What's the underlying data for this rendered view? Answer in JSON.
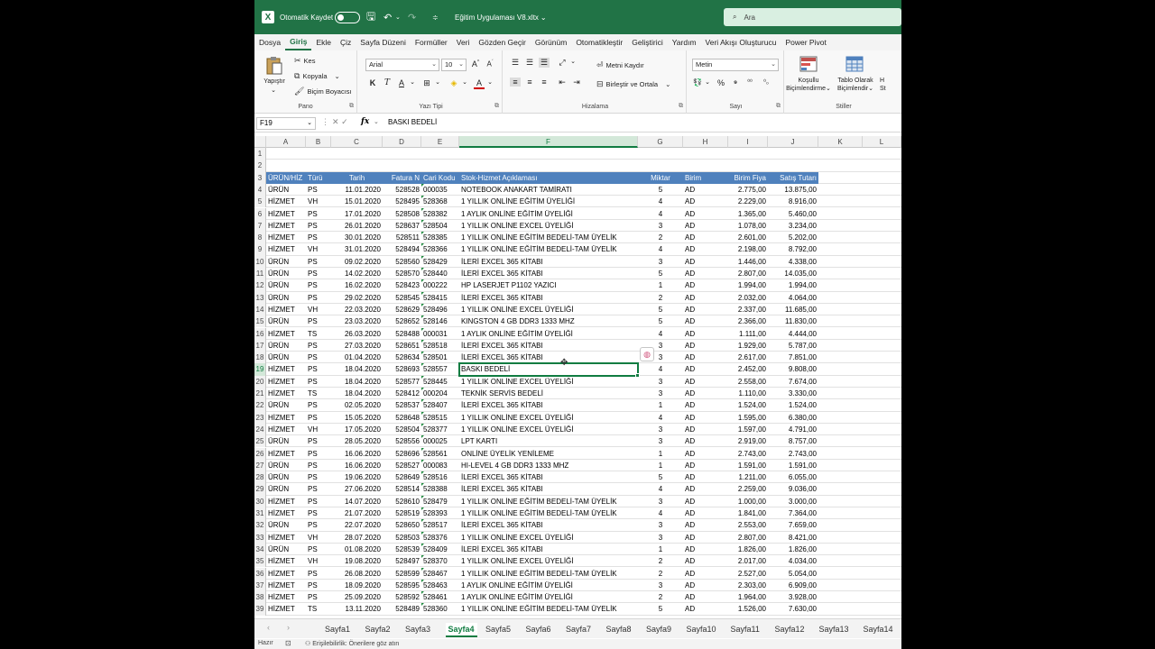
{
  "titlebar": {
    "autosave_label": "Otomatik Kaydet",
    "autosave_state": "off",
    "filename": "Eğitim Uygulaması V8.xltx",
    "search_placeholder": "Ara"
  },
  "menu_tabs": [
    "Dosya",
    "Giriş",
    "Ekle",
    "Çiz",
    "Sayfa Düzeni",
    "Formüller",
    "Veri",
    "Gözden Geçir",
    "Görünüm",
    "Otomatikleştir",
    "Geliştirici",
    "Yardım",
    "Veri Akışı Oluşturucu",
    "Power Pivot"
  ],
  "active_menu_tab": "Giriş",
  "ribbon": {
    "clipboard": {
      "paste": "Yapıştır",
      "cut": "Kes",
      "copy": "Kopyala",
      "format_painter": "Biçim Boyacısı",
      "group": "Pano"
    },
    "font": {
      "name": "Arial",
      "size": "10",
      "bold": "K",
      "italic": "T",
      "underline": "A",
      "group": "Yazı Tipi"
    },
    "alignment": {
      "wrap": "Metni Kaydır",
      "merge": "Birleştir ve Ortala",
      "group": "Hizalama"
    },
    "number": {
      "format": "Metin",
      "group": "Sayı"
    },
    "styles": {
      "conditional_line1": "Koşullu",
      "conditional_line2": "Biçimlendirme",
      "table_line1": "Tablo Olarak",
      "table_line2": "Biçimlendir",
      "cell_line1": "H",
      "cell_line2": "St",
      "group": "Stiller"
    }
  },
  "formula_bar": {
    "name_box": "F19",
    "fx": "fx",
    "content": "BASKI BEDELİ"
  },
  "columns": [
    "A",
    "B",
    "C",
    "D",
    "E",
    "F",
    "G",
    "H",
    "I",
    "J",
    "K",
    "L"
  ],
  "selected_column": "F",
  "selected_row": "19",
  "row_numbers": [
    "1",
    "2",
    "3",
    "4",
    "5",
    "6",
    "7",
    "8",
    "9",
    "10",
    "11",
    "12",
    "13",
    "14",
    "15",
    "16",
    "17",
    "18",
    "19",
    "20",
    "21",
    "22",
    "23",
    "24",
    "25",
    "26",
    "27",
    "28",
    "29",
    "30",
    "31",
    "32",
    "33",
    "34",
    "35",
    "36",
    "37",
    "38",
    "39"
  ],
  "table_headers": [
    "ÜRÜN/HİZ",
    "Türü",
    "Tarih",
    "Fatura N",
    "Cari Kodu",
    "Stok-Hizmet Açıklaması",
    "Miktar",
    "Birim",
    "Birim Fiya",
    "Satış Tutarı"
  ],
  "rows": [
    [
      "ÜRÜN",
      "PS",
      "11.01.2020",
      "528528",
      "000035",
      "NOTEBOOK ANAKART TAMİRATI",
      "5",
      "AD",
      "2.775,00",
      "13.875,00"
    ],
    [
      "HİZMET",
      "VH",
      "15.01.2020",
      "528495",
      "528368",
      "1 YILLIK ONLİNE EĞİTİM ÜYELİĞİ",
      "4",
      "AD",
      "2.229,00",
      "8.916,00"
    ],
    [
      "HİZMET",
      "PS",
      "17.01.2020",
      "528508",
      "528382",
      "1 AYLIK ONLİNE EĞİTİM ÜYELİĞİ",
      "4",
      "AD",
      "1.365,00",
      "5.460,00"
    ],
    [
      "HİZMET",
      "PS",
      "26.01.2020",
      "528637",
      "528504",
      "1 YILLIK ONLİNE EXCEL ÜYELİĞİ",
      "3",
      "AD",
      "1.078,00",
      "3.234,00"
    ],
    [
      "HİZMET",
      "PS",
      "30.01.2020",
      "528511",
      "528385",
      "1 YILLIK ONLİNE EĞİTİM BEDELİ-TAM ÜYELİK",
      "2",
      "AD",
      "2.601,00",
      "5.202,00"
    ],
    [
      "HİZMET",
      "VH",
      "31.01.2020",
      "528494",
      "528366",
      "1 YILLIK ONLİNE EĞİTİM BEDELİ-TAM ÜYELİK",
      "4",
      "AD",
      "2.198,00",
      "8.792,00"
    ],
    [
      "ÜRÜN",
      "PS",
      "09.02.2020",
      "528560",
      "528429",
      "İLERİ EXCEL 365 KİTABI",
      "3",
      "AD",
      "1.446,00",
      "4.338,00"
    ],
    [
      "ÜRÜN",
      "PS",
      "14.02.2020",
      "528570",
      "528440",
      "İLERİ EXCEL 365 KİTABI",
      "5",
      "AD",
      "2.807,00",
      "14.035,00"
    ],
    [
      "ÜRÜN",
      "PS",
      "16.02.2020",
      "528423",
      "000222",
      "HP LASERJET P1102 YAZICI",
      "1",
      "AD",
      "1.994,00",
      "1.994,00"
    ],
    [
      "ÜRÜN",
      "PS",
      "29.02.2020",
      "528545",
      "528415",
      "İLERİ EXCEL 365 KİTABI",
      "2",
      "AD",
      "2.032,00",
      "4.064,00"
    ],
    [
      "HİZMET",
      "VH",
      "22.03.2020",
      "528629",
      "528496",
      "1 YILLIK ONLİNE EXCEL ÜYELİĞİ",
      "5",
      "AD",
      "2.337,00",
      "11.685,00"
    ],
    [
      "ÜRÜN",
      "PS",
      "23.03.2020",
      "528652",
      "528146",
      "KINGSTON 4 GB DDR3 1333 MHZ",
      "5",
      "AD",
      "2.366,00",
      "11.830,00"
    ],
    [
      "HİZMET",
      "TS",
      "26.03.2020",
      "528488",
      "000031",
      "1 AYLIK ONLİNE EĞİTİM ÜYELİĞİ",
      "4",
      "AD",
      "1.111,00",
      "4.444,00"
    ],
    [
      "ÜRÜN",
      "PS",
      "27.03.2020",
      "528651",
      "528518",
      "İLERİ EXCEL 365 KİTABI",
      "3",
      "AD",
      "1.929,00",
      "5.787,00"
    ],
    [
      "ÜRÜN",
      "PS",
      "01.04.2020",
      "528634",
      "528501",
      "İLERİ EXCEL 365 KİTABI",
      "3",
      "AD",
      "2.617,00",
      "7.851,00"
    ],
    [
      "HİZMET",
      "PS",
      "18.04.2020",
      "528693",
      "528557",
      "BASKI BEDELİ",
      "4",
      "AD",
      "2.452,00",
      "9.808,00"
    ],
    [
      "HİZMET",
      "PS",
      "18.04.2020",
      "528577",
      "528445",
      "1 YILLIK ONLİNE EXCEL ÜYELİĞİ",
      "3",
      "AD",
      "2.558,00",
      "7.674,00"
    ],
    [
      "HİZMET",
      "TS",
      "18.04.2020",
      "528412",
      "000204",
      "TEKNİK SERVİS BEDELİ",
      "3",
      "AD",
      "1.110,00",
      "3.330,00"
    ],
    [
      "ÜRÜN",
      "PS",
      "02.05.2020",
      "528537",
      "528407",
      "İLERİ EXCEL 365 KİTABI",
      "1",
      "AD",
      "1.524,00",
      "1.524,00"
    ],
    [
      "HİZMET",
      "PS",
      "15.05.2020",
      "528648",
      "528515",
      "1 YILLIK ONLİNE EXCEL ÜYELİĞİ",
      "4",
      "AD",
      "1.595,00",
      "6.380,00"
    ],
    [
      "HİZMET",
      "VH",
      "17.05.2020",
      "528504",
      "528377",
      "1 YILLIK ONLİNE EXCEL ÜYELİĞİ",
      "3",
      "AD",
      "1.597,00",
      "4.791,00"
    ],
    [
      "ÜRÜN",
      "PS",
      "28.05.2020",
      "528556",
      "000025",
      "LPT KARTI",
      "3",
      "AD",
      "2.919,00",
      "8.757,00"
    ],
    [
      "HİZMET",
      "PS",
      "16.06.2020",
      "528696",
      "528561",
      "ONLİNE ÜYELİK YENİLEME",
      "1",
      "AD",
      "2.743,00",
      "2.743,00"
    ],
    [
      "ÜRÜN",
      "PS",
      "16.06.2020",
      "528527",
      "000083",
      "HI-LEVEL 4 GB DDR3 1333 MHZ",
      "1",
      "AD",
      "1.591,00",
      "1.591,00"
    ],
    [
      "ÜRÜN",
      "PS",
      "19.06.2020",
      "528649",
      "528516",
      "İLERİ EXCEL 365 KİTABI",
      "5",
      "AD",
      "1.211,00",
      "6.055,00"
    ],
    [
      "ÜRÜN",
      "PS",
      "27.06.2020",
      "528514",
      "528388",
      "İLERİ EXCEL 365 KİTABI",
      "4",
      "AD",
      "2.259,00",
      "9.036,00"
    ],
    [
      "HİZMET",
      "PS",
      "14.07.2020",
      "528610",
      "528479",
      "1 YILLIK ONLİNE EĞİTİM BEDELİ-TAM ÜYELİK",
      "3",
      "AD",
      "1.000,00",
      "3.000,00"
    ],
    [
      "HİZMET",
      "PS",
      "21.07.2020",
      "528519",
      "528393",
      "1 YILLIK ONLİNE EĞİTİM BEDELİ-TAM ÜYELİK",
      "4",
      "AD",
      "1.841,00",
      "7.364,00"
    ],
    [
      "ÜRÜN",
      "PS",
      "22.07.2020",
      "528650",
      "528517",
      "İLERİ EXCEL 365 KİTABI",
      "3",
      "AD",
      "2.553,00",
      "7.659,00"
    ],
    [
      "HİZMET",
      "VH",
      "28.07.2020",
      "528503",
      "528376",
      "1 YILLIK ONLİNE EXCEL ÜYELİĞİ",
      "3",
      "AD",
      "2.807,00",
      "8.421,00"
    ],
    [
      "ÜRÜN",
      "PS",
      "01.08.2020",
      "528539",
      "528409",
      "İLERİ EXCEL 365 KİTABI",
      "1",
      "AD",
      "1.826,00",
      "1.826,00"
    ],
    [
      "HİZMET",
      "VH",
      "19.08.2020",
      "528497",
      "528370",
      "1 YILLIK ONLİNE EXCEL ÜYELİĞİ",
      "2",
      "AD",
      "2.017,00",
      "4.034,00"
    ],
    [
      "HİZMET",
      "PS",
      "26.08.2020",
      "528599",
      "528467",
      "1 YILLIK ONLİNE EĞİTİM BEDELİ-TAM ÜYELİK",
      "2",
      "AD",
      "2.527,00",
      "5.054,00"
    ],
    [
      "HİZMET",
      "PS",
      "18.09.2020",
      "528595",
      "528463",
      "1 AYLIK ONLİNE EĞİTİM ÜYELİĞİ",
      "3",
      "AD",
      "2.303,00",
      "6.909,00"
    ],
    [
      "HİZMET",
      "PS",
      "25.09.2020",
      "528592",
      "528461",
      "1 AYLIK ONLİNE EĞİTİM ÜYELİĞİ",
      "2",
      "AD",
      "1.964,00",
      "3.928,00"
    ],
    [
      "HİZMET",
      "TS",
      "13.11.2020",
      "528489",
      "528360",
      "1 YILLIK ONLİNE EĞİTİM BEDELİ-TAM ÜYELİK",
      "5",
      "AD",
      "1.526,00",
      "7.630,00"
    ]
  ],
  "sheet_tabs": [
    "Sayfa1",
    "Sayfa2",
    "Sayfa3",
    "Sayfa4",
    "Sayfa5",
    "Sayfa6",
    "Sayfa7",
    "Sayfa8",
    "Sayfa9",
    "Sayfa10",
    "Sayfa11",
    "Sayfa12",
    "Sayfa13",
    "Sayfa14"
  ],
  "active_sheet": "Sayfa4",
  "statusbar": {
    "ready": "Hazır",
    "accessibility": "Erişilebilirlik: Önerilere göz atın"
  },
  "colors": {
    "excel_green": "#217346",
    "header_fill": "#4f81bd",
    "selection": "#107c41"
  }
}
